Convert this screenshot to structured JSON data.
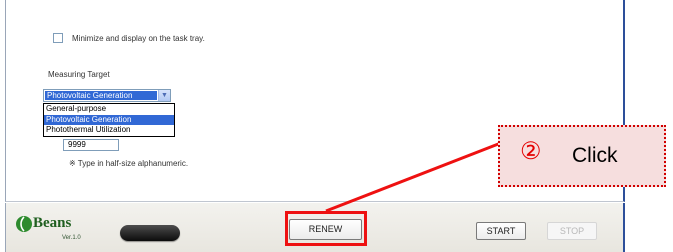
{
  "options": {
    "minimize_tray_label": "Minimize and display on the task tray."
  },
  "measuring_target": {
    "label": "Measuring Target",
    "selected": "Photovoltaic Generation",
    "dropdown_options": [
      "General-purpose",
      "Photovoltaic Generation",
      "Photothermal Utilization"
    ]
  },
  "input": {
    "value": "9999",
    "note": "※ Type in half-size alphanumeric."
  },
  "footer": {
    "logo_text": "Beans",
    "logo_version": "Ver.1.0",
    "renew_label": "RENEW",
    "start_label": "START",
    "stop_label": "STOP"
  },
  "callout": {
    "icon": "②",
    "label": "Click"
  },
  "colors": {
    "highlight": "#ee1111",
    "selection": "#3168d5",
    "callout_fill": "#f6dede"
  }
}
